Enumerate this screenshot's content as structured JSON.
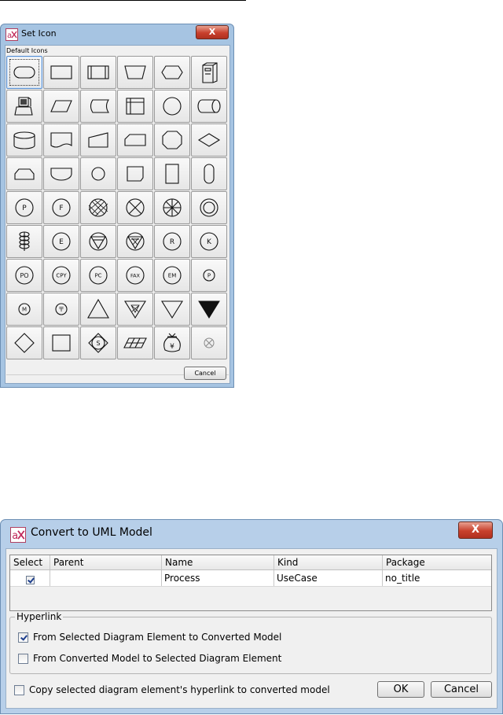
{
  "set_icon_dialog": {
    "title": "Set Icon",
    "close_label": "X",
    "group_label": "Default Icons",
    "cancel_label": "Cancel",
    "icons": [
      {
        "name": "terminator-icon"
      },
      {
        "name": "process-icon"
      },
      {
        "name": "predefined-process-icon"
      },
      {
        "name": "manual-operation-icon"
      },
      {
        "name": "preparation-icon"
      },
      {
        "name": "server-icon"
      },
      {
        "name": "computer-icon"
      },
      {
        "name": "data-icon"
      },
      {
        "name": "stored-data-icon"
      },
      {
        "name": "internal-storage-icon"
      },
      {
        "name": "circle-icon"
      },
      {
        "name": "direct-access-storage-icon"
      },
      {
        "name": "database-icon"
      },
      {
        "name": "document-icon"
      },
      {
        "name": "manual-input-icon"
      },
      {
        "name": "card-icon"
      },
      {
        "name": "octagon-icon"
      },
      {
        "name": "decision-icon"
      },
      {
        "name": "loop-limit-icon"
      },
      {
        "name": "display-icon"
      },
      {
        "name": "small-circle-icon"
      },
      {
        "name": "punched-card-icon"
      },
      {
        "name": "rectangle-icon"
      },
      {
        "name": "capsule-icon"
      },
      {
        "name": "circle-p-icon",
        "label": "P"
      },
      {
        "name": "circle-f-icon",
        "label": "F"
      },
      {
        "name": "circle-hatched-x-icon"
      },
      {
        "name": "circle-x-icon"
      },
      {
        "name": "circle-star-icon"
      },
      {
        "name": "double-circle-icon"
      },
      {
        "name": "stacked-coil-icon"
      },
      {
        "name": "circle-e-icon",
        "label": "E"
      },
      {
        "name": "circle-triangle-icon"
      },
      {
        "name": "circle-triangle-x-icon"
      },
      {
        "name": "circle-r-icon",
        "label": "R"
      },
      {
        "name": "circle-k-icon",
        "label": "K"
      },
      {
        "name": "circle-po-icon",
        "label": "PO"
      },
      {
        "name": "circle-cpy-icon",
        "label": "CPY"
      },
      {
        "name": "circle-pc-icon",
        "label": "PC"
      },
      {
        "name": "circle-fax-icon",
        "label": "FAX"
      },
      {
        "name": "circle-em-icon",
        "label": "EM"
      },
      {
        "name": "small-circle-p-icon",
        "label": "P"
      },
      {
        "name": "small-circle-m-icon",
        "label": "M"
      },
      {
        "name": "small-circle-postal-icon",
        "label": "〒"
      },
      {
        "name": "triangle-up-icon"
      },
      {
        "name": "triangle-down-x-icon"
      },
      {
        "name": "triangle-down-icon"
      },
      {
        "name": "triangle-down-filled-icon"
      },
      {
        "name": "diamond-icon"
      },
      {
        "name": "square-icon"
      },
      {
        "name": "circle-dollar-icon",
        "label": "S"
      },
      {
        "name": "grid-plate-icon"
      },
      {
        "name": "money-bag-yen-icon",
        "label": "¥"
      },
      {
        "name": "small-circle-x-icon"
      }
    ]
  },
  "convert_dialog": {
    "title": "Convert to UML Model",
    "close_label": "X",
    "table": {
      "headers": [
        "Select",
        "Parent",
        "Name",
        "Kind",
        "Package"
      ],
      "rows": [
        {
          "selected": true,
          "parent": "",
          "name": "Process",
          "kind": "UseCase",
          "package": "no_title"
        }
      ]
    },
    "hyperlink": {
      "legend": "Hyperlink",
      "options": [
        {
          "label": "From Selected Diagram Element to Converted Model",
          "checked": true
        },
        {
          "label": "From Converted Model to Selected Diagram Element",
          "checked": false
        }
      ]
    },
    "copy_hyperlink": {
      "label": "Copy selected diagram element's hyperlink to converted model",
      "checked": false
    },
    "ok_label": "OK",
    "cancel_label": "Cancel"
  }
}
